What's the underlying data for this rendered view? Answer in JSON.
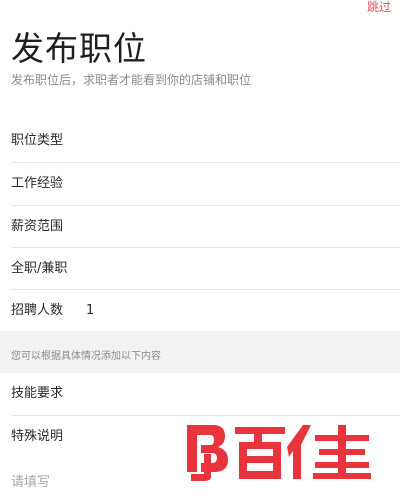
{
  "header": {
    "skip_label": "跳过",
    "title": "发布职位",
    "subtitle": "发布职位后，求职者才能看到你的店铺和职位"
  },
  "form": {
    "rows": [
      {
        "label": "职位类型",
        "value": ""
      },
      {
        "label": "工作经验",
        "value": ""
      },
      {
        "label": "薪资范围",
        "value": ""
      },
      {
        "label": "全职/兼职",
        "value": ""
      },
      {
        "label": "招聘人数",
        "value": "1"
      }
    ],
    "extra_hint": "您可以根据具体情况添加以下内容",
    "extra_rows": [
      {
        "label": "技能要求"
      },
      {
        "label": "特殊说明"
      }
    ],
    "textarea_placeholder": "请填写"
  },
  "watermark": {
    "text": "BJ百佳",
    "color": "#e8353d"
  }
}
